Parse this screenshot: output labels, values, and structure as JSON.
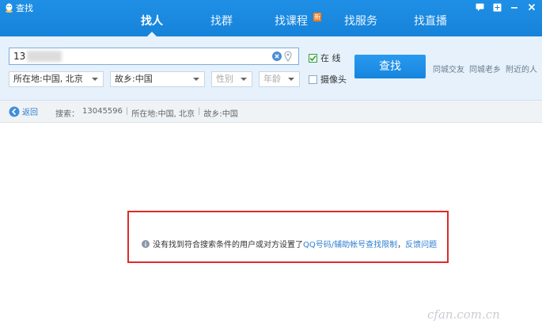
{
  "window": {
    "title": "查找",
    "controls": [
      "feedback-icon",
      "skin-icon",
      "minimize-icon",
      "close-icon"
    ]
  },
  "tabs": [
    {
      "label": "找人",
      "active": true
    },
    {
      "label": "找群",
      "active": false
    },
    {
      "label": "找课程",
      "active": false,
      "badge": "新"
    },
    {
      "label": "找服务",
      "active": false
    },
    {
      "label": "找直播",
      "active": false
    }
  ],
  "search": {
    "keyword_value": "13",
    "location_select": "所在地:中国, 北京",
    "hometown_select": "故乡:中国",
    "gender_select": "性别",
    "age_select": "年龄",
    "online_label": "在 线",
    "online_checked": true,
    "camera_label": "摄像头",
    "camera_checked": false,
    "button_label": "查找",
    "quick_links": [
      "同城交友",
      "同城老乡",
      "附近的人"
    ]
  },
  "result_bar": {
    "back_label": "返回",
    "search_label": "搜索：",
    "search_value": "13045596",
    "location_text": "所在地:中国, 北京",
    "hometown_text": "故乡:中国",
    "separator": "|"
  },
  "notice": {
    "message": "没有找到符合搜索条件的用户或对方设置了",
    "link1": "QQ号码/辅助帐号查找限制",
    "comma": "，",
    "link2": "反馈问题"
  },
  "watermark": "cfan.com.cn",
  "colors": {
    "titlebar": "#1683d9",
    "panel": "#e6f1fb",
    "button": "#1b8de6",
    "link": "#2d7fd0",
    "highlight_box": "#dd2a2a",
    "badge": "#ff7d1a"
  }
}
